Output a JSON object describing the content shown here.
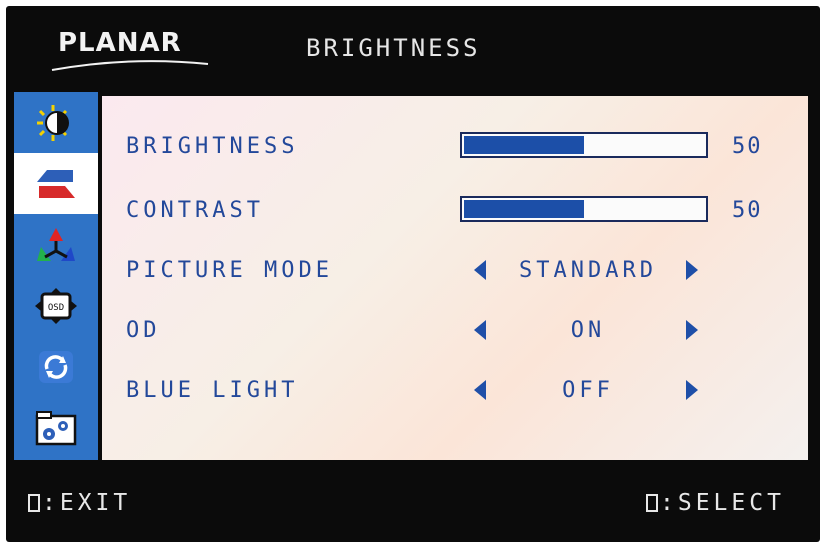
{
  "header": {
    "brand": "PLANAR",
    "title": "BRIGHTNESS"
  },
  "sidebar": {
    "items": [
      {
        "icon": "brightness-contrast-icon",
        "active": false
      },
      {
        "icon": "image-settings-icon",
        "active": true
      },
      {
        "icon": "color-icon",
        "active": false
      },
      {
        "icon": "osd-icon",
        "active": false
      },
      {
        "icon": "reset-icon",
        "active": false
      },
      {
        "icon": "setup-icon",
        "active": false
      }
    ]
  },
  "menu": {
    "brightness": {
      "label": "BRIGHTNESS",
      "value": "50",
      "level": 50
    },
    "contrast": {
      "label": "CONTRAST",
      "value": "50",
      "level": 50
    },
    "picture_mode": {
      "label": "PICTURE MODE",
      "value": "STANDARD"
    },
    "od": {
      "label": "OD",
      "value": "ON"
    },
    "blue_light": {
      "label": "BLUE LIGHT",
      "value": "OFF"
    }
  },
  "footer": {
    "exit_text": ":EXIT",
    "select_text": ":SELECT"
  },
  "colors": {
    "sidebar": "#2f73c6",
    "text": "#23489a",
    "bar": "#1c4fa8",
    "frame": "#0b0b0b"
  }
}
